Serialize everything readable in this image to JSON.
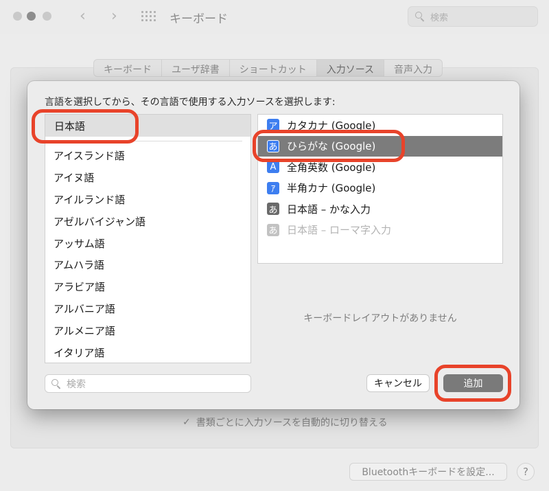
{
  "window": {
    "title": "キーボード",
    "search_placeholder": "検索",
    "back_icon": "chevron-left-icon",
    "forward_icon": "chevron-right-icon"
  },
  "tabs": [
    {
      "label": "キーボード"
    },
    {
      "label": "ユーザ辞書"
    },
    {
      "label": "ショートカット"
    },
    {
      "label": "入力ソース",
      "active": true
    },
    {
      "label": "音声入力"
    }
  ],
  "dialog": {
    "prompt": "言語を選択してから、その言語で使用する入力ソースを選択します:",
    "selected_language": "日本語",
    "languages": [
      "アイスランド語",
      "アイヌ語",
      "アイルランド語",
      "アゼルバイジャン語",
      "アッサム語",
      "アムハラ語",
      "アラビア語",
      "アルバニア語",
      "アルメニア語",
      "イタリア語"
    ],
    "input_sources": [
      {
        "icon": "ア",
        "label": "カタカナ (Google)",
        "style": "blue"
      },
      {
        "icon": "あ",
        "label": "ひらがな (Google)",
        "style": "blue",
        "selected": true
      },
      {
        "icon": "A",
        "label": "全角英数 (Google)",
        "style": "blue"
      },
      {
        "icon": "ｱ",
        "label": "半角カナ (Google)",
        "style": "blue"
      },
      {
        "icon": "あ",
        "label": "日本語 – かな入力",
        "style": "gray"
      },
      {
        "icon": "あ",
        "label": "日本語 – ローマ字入力",
        "style": "disabled"
      }
    ],
    "no_layout_text": "キーボードレイアウトがありません",
    "search_placeholder": "検索",
    "cancel_label": "キャンセル",
    "add_label": "追加"
  },
  "footer": {
    "auto_switch_label": "書類ごとに入力ソースを自動的に切り替える",
    "auto_switch_checked": true,
    "bluetooth_label": "Bluetoothキーボードを設定...",
    "help_label": "?"
  },
  "colors": {
    "highlight_ring": "#e8432a",
    "selected_row": "#7c7c7c",
    "source_icon_blue": "#3d7ef0"
  }
}
